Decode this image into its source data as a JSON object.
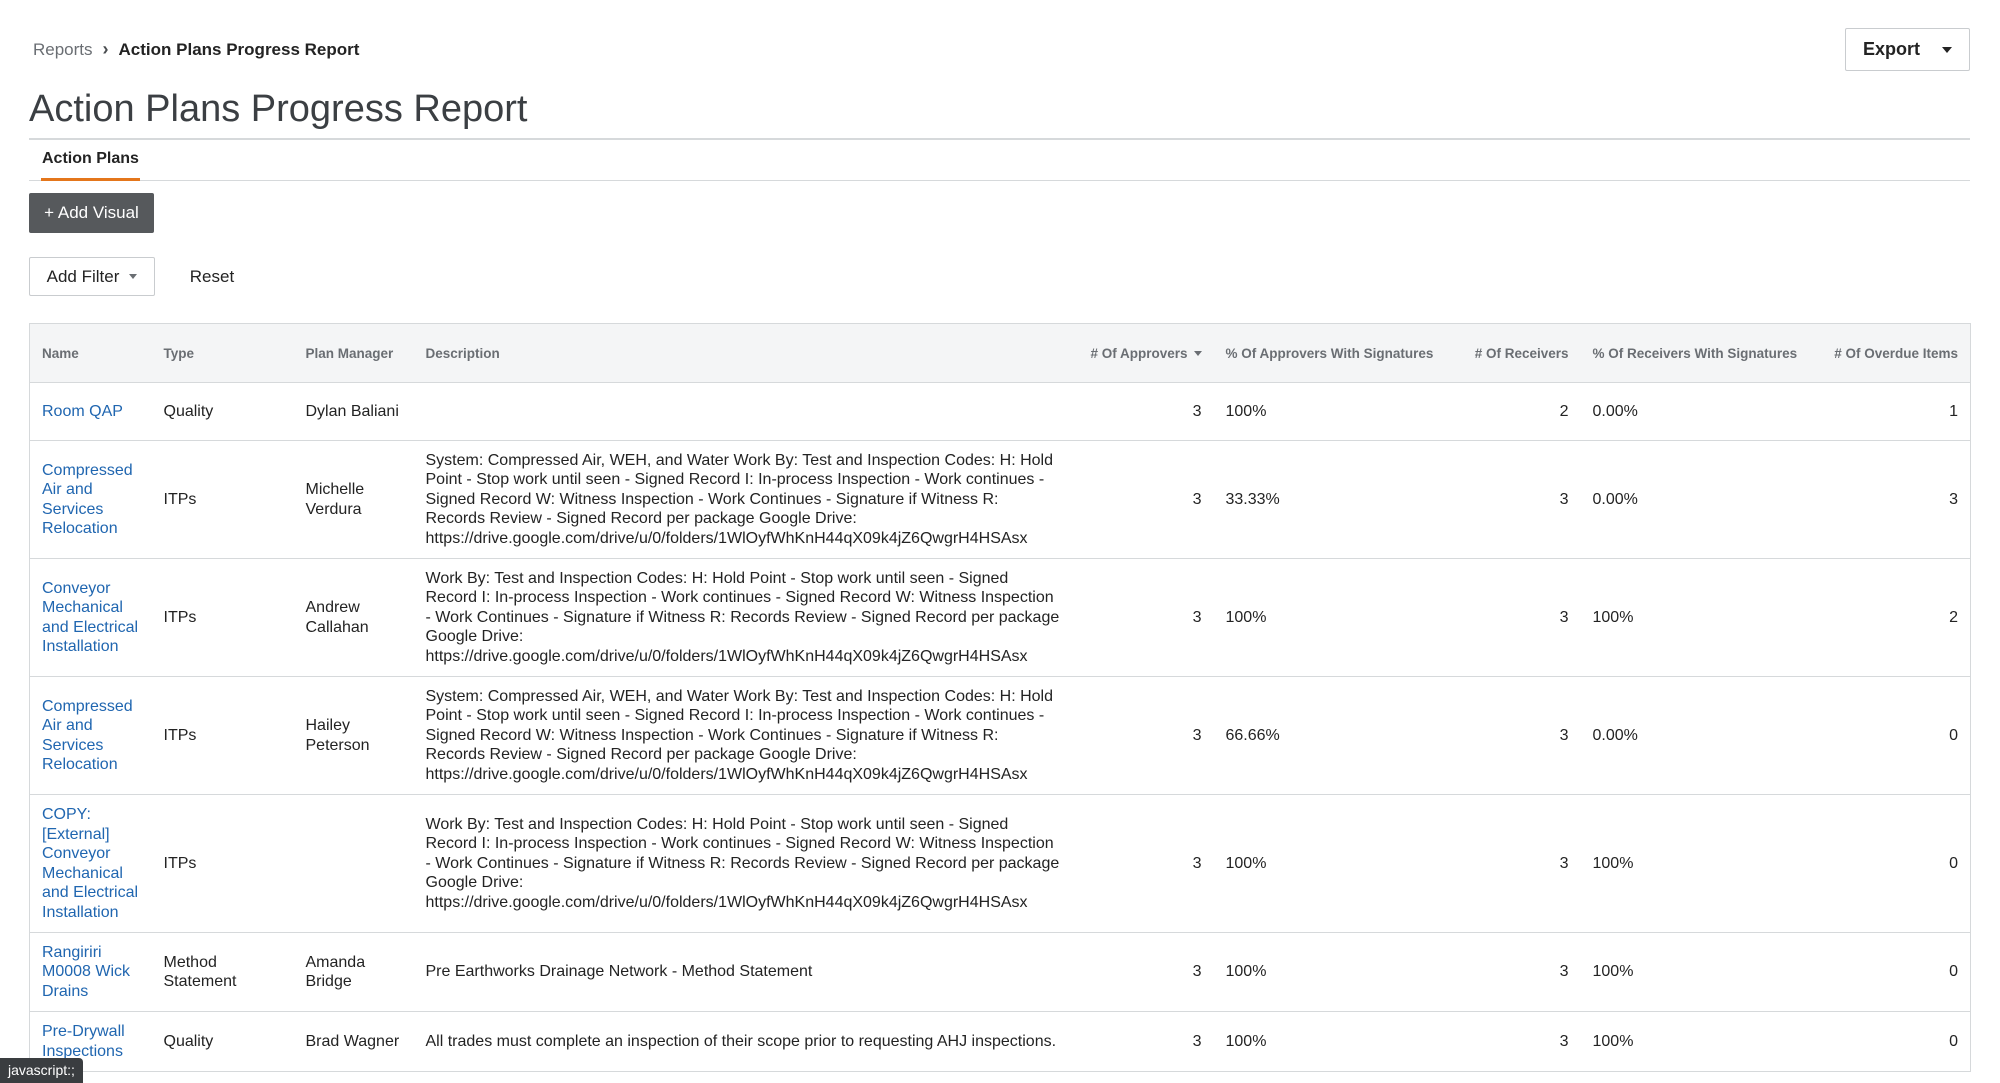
{
  "breadcrumb": {
    "parent": "Reports",
    "current": "Action Plans Progress Report"
  },
  "header": {
    "export_label": "Export"
  },
  "page_title": "Action Plans Progress Report",
  "tabs": [
    {
      "label": "Action Plans",
      "active": true
    }
  ],
  "toolbar": {
    "add_visual_label": "+ Add Visual",
    "add_filter_label": "Add Filter",
    "reset_label": "Reset"
  },
  "table": {
    "columns": {
      "name": "Name",
      "type": "Type",
      "plan_manager": "Plan Manager",
      "description": "Description",
      "approvers": "# Of Approvers",
      "approvers_pct": "% Of Approvers With Signatures",
      "receivers": "# Of Receivers",
      "receivers_pct": "% Of Receivers With Signatures",
      "overdue": "# Of Overdue Items"
    },
    "rows": [
      {
        "name": "Room QAP",
        "type": "Quality",
        "manager": "Dylan Baliani",
        "description": "",
        "approvers": "3",
        "approvers_pct": "100%",
        "receivers": "2",
        "receivers_pct": "0.00%",
        "overdue": "1"
      },
      {
        "name": "Compressed Air and Services Relocation",
        "type": "ITPs",
        "manager": "Michelle Verdura",
        "description": "System: Compressed Air, WEH, and Water Work By: Test and Inspection Codes:  H: Hold Point - Stop work until seen - Signed Record I: In-process Inspection - Work continues - Signed Record W: Witness Inspection - Work Continues - Signature if Witness R: Records Review - Signed Record per package Google Drive: https://drive.google.com/drive/u/0/folders/1WlOyfWhKnH44qX09k4jZ6QwgrH4HSAsx",
        "approvers": "3",
        "approvers_pct": "33.33%",
        "receivers": "3",
        "receivers_pct": "0.00%",
        "overdue": "3"
      },
      {
        "name": "Conveyor Mechanical and Electrical Installation",
        "type": "ITPs",
        "manager": "Andrew Callahan",
        "description": "Work By: Test and Inspection Codes:  H: Hold Point - Stop work until seen - Signed Record I: In-process Inspection - Work continues - Signed Record W: Witness Inspection - Work Continues - Signature if Witness R: Records Review - Signed Record per package  Google Drive: https://drive.google.com/drive/u/0/folders/1WlOyfWhKnH44qX09k4jZ6QwgrH4HSAsx",
        "approvers": "3",
        "approvers_pct": "100%",
        "receivers": "3",
        "receivers_pct": "100%",
        "overdue": "2"
      },
      {
        "name": "Compressed Air and Services Relocation",
        "type": "ITPs",
        "manager": "Hailey Peterson",
        "description": "System: Compressed Air, WEH, and Water Work By: Test and Inspection Codes:  H: Hold Point - Stop work until seen - Signed Record I: In-process Inspection - Work continues - Signed Record W: Witness Inspection - Work Continues - Signature if Witness R: Records Review - Signed Record per package Google Drive: https://drive.google.com/drive/u/0/folders/1WlOyfWhKnH44qX09k4jZ6QwgrH4HSAsx",
        "approvers": "3",
        "approvers_pct": "66.66%",
        "receivers": "3",
        "receivers_pct": "0.00%",
        "overdue": "0"
      },
      {
        "name": "COPY: [External] Conveyor Mechanical and Electrical Installation",
        "type": "ITPs",
        "manager": "",
        "description": "Work By: Test and Inspection Codes:  H: Hold Point - Stop work until seen - Signed Record I: In-process Inspection - Work continues - Signed Record W: Witness Inspection - Work Continues - Signature if Witness R: Records Review - Signed Record per package  Google Drive: https://drive.google.com/drive/u/0/folders/1WlOyfWhKnH44qX09k4jZ6QwgrH4HSAsx",
        "approvers": "3",
        "approvers_pct": "100%",
        "receivers": "3",
        "receivers_pct": "100%",
        "overdue": "0"
      },
      {
        "name": "Rangiriri M0008 Wick Drains",
        "type": "Method Statement",
        "manager": "Amanda Bridge",
        "description": "Pre Earthworks Drainage Network - Method Statement",
        "approvers": "3",
        "approvers_pct": "100%",
        "receivers": "3",
        "receivers_pct": "100%",
        "overdue": "0"
      },
      {
        "name": "Pre-Drywall Inspections",
        "type": "Quality",
        "manager": "Brad Wagner",
        "description": "All trades must complete an inspection of their scope prior to requesting AHJ inspections.",
        "approvers": "3",
        "approvers_pct": "100%",
        "receivers": "3",
        "receivers_pct": "100%",
        "overdue": "0"
      }
    ]
  },
  "status_bar": {
    "text": "javascript:;"
  }
}
